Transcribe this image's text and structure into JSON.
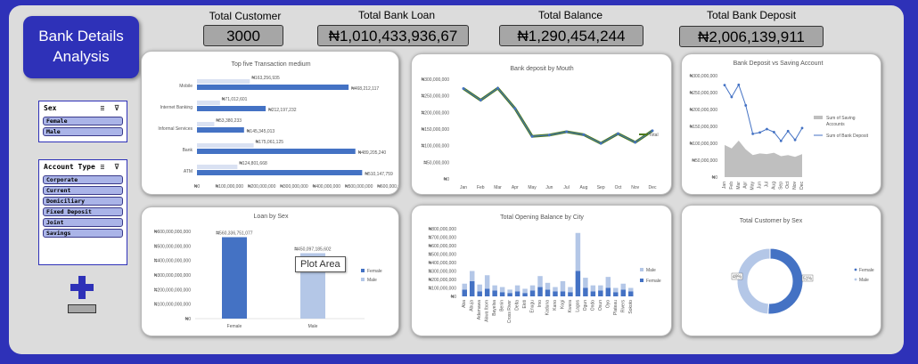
{
  "title": "Bank Details Analysis",
  "kpis": {
    "customers": {
      "label": "Total Customer",
      "value": "3000"
    },
    "loan": {
      "label": "Total Bank Loan",
      "value": "₦1,010,433,936,67"
    },
    "balance": {
      "label": "Total Balance",
      "value": "₦1,290,454,244"
    },
    "deposit": {
      "label": "Total  Bank Deposit",
      "value": "₦2,006,139,911"
    }
  },
  "slicers": {
    "sex": {
      "title": "Sex",
      "items": [
        "Female",
        "Male"
      ]
    },
    "account": {
      "title": "Account Type",
      "items": [
        "Corporate",
        "Current",
        "Domiciliary",
        "Fixed Deposit",
        "Joint",
        "Savings"
      ]
    }
  },
  "colors": {
    "dark_blue": "#4472c4",
    "light_blue": "#b4c7e7",
    "green": "#4e7a1e",
    "gray": "#a6a6a6",
    "navy": "#2e31b8"
  },
  "tooltip": "Plot Area",
  "chart_data": [
    {
      "type": "bar",
      "title": "Top five Transaction medium",
      "categories": [
        "Mobile",
        "Internet Banking",
        "Informal Services",
        "Bank",
        "ATM"
      ],
      "series": [
        {
          "values_label": [
            "₦163,256,935",
            "₦71,012,601",
            "₦53,380,233",
            "₦175,061,125",
            "₦124,801,668"
          ],
          "values": [
            163256935,
            71012601,
            53380233,
            175061125,
            124801668
          ]
        },
        {
          "values_label": [
            "₦468,212,117",
            "₦212,197,232",
            "₦145,345,013",
            "₦489,205,240",
            "₦510,147,759"
          ],
          "values": [
            468212117,
            212197232,
            145345013,
            489205240,
            510147759
          ]
        }
      ],
      "xticks": [
        "₦0",
        "₦100,000,000",
        "₦200,000,000",
        "₦300,000,000",
        "₦400,000,000",
        "₦500,000,000",
        "₦600,000,000"
      ],
      "xlim": [
        0,
        600000000
      ]
    },
    {
      "type": "line",
      "title": "Bank deposit by Mouth",
      "categories": [
        "Jan",
        "Feb",
        "Mar",
        "Apr",
        "May",
        "Jun",
        "Jul",
        "Aug",
        "Sep",
        "Oct",
        "Nov",
        "Dec"
      ],
      "series": [
        {
          "name": "Total",
          "values": [
            272000000,
            237000000,
            273000000,
            212000000,
            128000000,
            132000000,
            142000000,
            133000000,
            107000000,
            136000000,
            110000000,
            145000000
          ]
        }
      ],
      "yticks": [
        "₦0",
        "₦50,000,000",
        "₦100,000,000",
        "₦150,000,000",
        "₦200,000,000",
        "₦250,000,000",
        "₦300,000,000"
      ],
      "ylim": [
        0,
        300000000
      ]
    },
    {
      "type": "area",
      "title": "Bank Deposit vs Saving Account",
      "categories": [
        "Jan",
        "Feb",
        "Mar",
        "Apr",
        "May",
        "Jun",
        "Jul",
        "Aug",
        "Sep",
        "Oct",
        "Nov",
        "Dec"
      ],
      "series": [
        {
          "name": "Sum of Saving Accounts",
          "values": [
            95000000,
            85000000,
            108000000,
            82000000,
            65000000,
            70000000,
            68000000,
            72000000,
            62000000,
            65000000,
            60000000,
            68000000
          ]
        },
        {
          "name": "Sum of Bank Deposit",
          "values": [
            272000000,
            237000000,
            273000000,
            212000000,
            128000000,
            132000000,
            142000000,
            133000000,
            107000000,
            136000000,
            110000000,
            145000000
          ]
        }
      ],
      "yticks": [
        "₦0",
        "₦50,000,000",
        "₦100,000,000",
        "₦150,000,000",
        "₦200,000,000",
        "₦250,000,000",
        "₦300,000,000"
      ],
      "ylim": [
        0,
        300000000
      ]
    },
    {
      "type": "bar",
      "title": "Loan by Sex",
      "categories": [
        "Female",
        "Male"
      ],
      "values": [
        560336751077,
        450097185602
      ],
      "value_labels": [
        "₦560,336,751,077",
        "₦450,097,185,602"
      ],
      "legend": [
        "Female",
        "Male"
      ],
      "yticks": [
        "₦0",
        "₦100,000,000,000",
        "₦200,000,000,000",
        "₦300,000,000,000",
        "₦400,000,000,000",
        "₦500,000,000,000",
        "₦600,000,000,000"
      ],
      "ylim": [
        0,
        600000000000
      ]
    },
    {
      "type": "bar",
      "title": "Total Opening Balance by City",
      "categories": [
        "Aba",
        "Abuja",
        "Adamawa",
        "Akwa Ibom",
        "Bayelsa",
        "Benin",
        "Cross River",
        "Delta",
        "Ekiti",
        "Enugu",
        "Imo",
        "Kaduna",
        "Kano",
        "Kogi",
        "Kwara",
        "Lagos",
        "Ogun",
        "Ondo",
        "Osun",
        "Oyo",
        "Plateau",
        "Rivers",
        "Sokoto"
      ],
      "series": [
        {
          "name": "Female",
          "values": [
            80000000,
            180000000,
            60000000,
            90000000,
            70000000,
            50000000,
            40000000,
            60000000,
            40000000,
            70000000,
            110000000,
            80000000,
            60000000,
            60000000,
            50000000,
            300000000,
            100000000,
            60000000,
            70000000,
            100000000,
            50000000,
            80000000,
            60000000
          ]
        },
        {
          "name": "Male",
          "values": [
            70000000,
            120000000,
            80000000,
            160000000,
            60000000,
            60000000,
            40000000,
            70000000,
            50000000,
            60000000,
            130000000,
            80000000,
            50000000,
            120000000,
            60000000,
            450000000,
            120000000,
            70000000,
            60000000,
            130000000,
            50000000,
            70000000,
            40000000
          ]
        }
      ],
      "legend": [
        "Male",
        "Female"
      ],
      "yticks": [
        "₦0",
        "₦100,000,000",
        "₦200,000,000",
        "₦300,000,000",
        "₦400,000,000",
        "₦500,000,000",
        "₦600,000,000",
        "₦700,000,000",
        "₦800,000,000"
      ],
      "ylim": [
        0,
        800000000
      ]
    },
    {
      "type": "pie",
      "title": "Total Customer by Sex",
      "categories": [
        "Female",
        "Male"
      ],
      "values": [
        51,
        49
      ],
      "value_labels": [
        "51%",
        "49%"
      ]
    }
  ]
}
